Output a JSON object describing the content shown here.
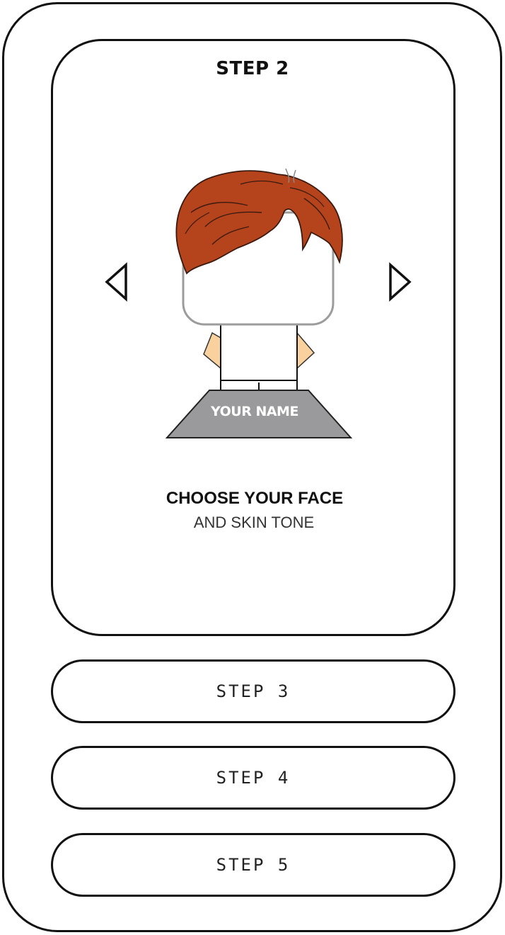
{
  "step_card": {
    "title": "STEP 2",
    "avatar": {
      "name_plate": "YOUR NAME",
      "hair_color": "#b5441c",
      "skin_color": "#f8d19e",
      "plate_color": "#9a9a9c"
    },
    "prev_icon": "triangle-left-icon",
    "next_icon": "triangle-right-icon",
    "heading": "CHOOSE YOUR FACE",
    "subheading": "AND SKIN TONE"
  },
  "steps": [
    {
      "label": "STEP 3"
    },
    {
      "label": "STEP 4"
    },
    {
      "label": "STEP 5"
    }
  ]
}
